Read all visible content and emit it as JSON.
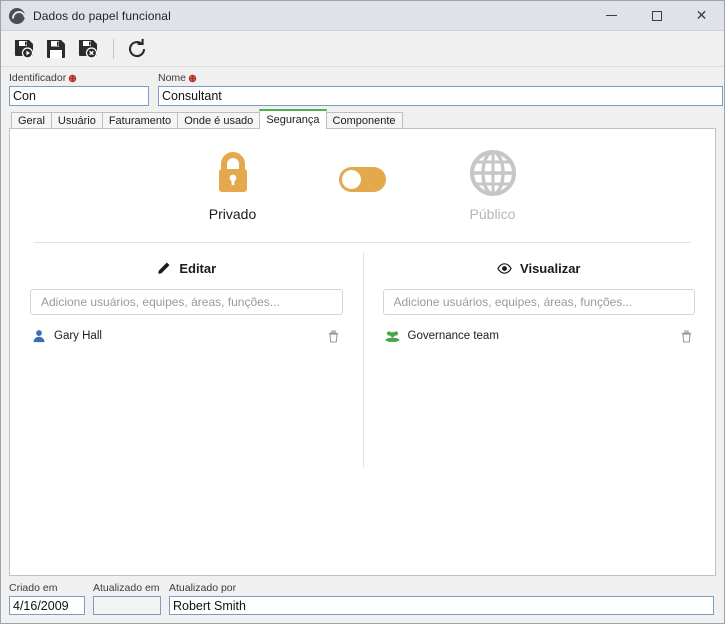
{
  "window": {
    "title": "Dados do papel funcional",
    "app_icon": "swoosh-circle-icon",
    "controls": {
      "minimize": "minimize-icon",
      "maximize": "maximize-icon",
      "close": "close-icon"
    }
  },
  "toolbar": {
    "buttons": [
      {
        "name": "save-new-button",
        "icon": "floppy-disk-new-icon"
      },
      {
        "name": "save-button",
        "icon": "floppy-disk-icon"
      },
      {
        "name": "save-delete-button",
        "icon": "floppy-disk-delete-icon"
      },
      {
        "name": "refresh-button",
        "icon": "refresh-icon"
      }
    ]
  },
  "header_fields": {
    "identificador": {
      "label": "Identificador",
      "value": "Con",
      "required": true
    },
    "nome": {
      "label": "Nome",
      "value": "Consultant",
      "required": true
    }
  },
  "tabs": [
    {
      "label": "Geral",
      "active": false
    },
    {
      "label": "Usuário",
      "active": false
    },
    {
      "label": "Faturamento",
      "active": false
    },
    {
      "label": "Onde é usado",
      "active": false
    },
    {
      "label": "Segurança",
      "active": true
    },
    {
      "label": "Componente",
      "active": false
    }
  ],
  "privacy": {
    "private": {
      "label": "Privado",
      "icon": "padlock-icon",
      "active": true
    },
    "public": {
      "label": "Público",
      "icon": "globe-icon",
      "active": false
    },
    "toggle": {
      "name": "privacy-toggle",
      "state": "off",
      "position": "left"
    }
  },
  "columns": {
    "edit": {
      "title": "Editar",
      "icon": "pencil-icon",
      "placeholder": "Adicione usuários, equipes, áreas, funções...",
      "value": "",
      "entries": [
        {
          "name": "Gary Hall",
          "type": "user",
          "icon": "user-icon",
          "delete_icon": "trash-icon"
        }
      ]
    },
    "view": {
      "title": "Visualizar",
      "icon": "eye-icon",
      "placeholder": "Adicione usuários, equipes, áreas, funções...",
      "value": "",
      "entries": [
        {
          "name": "Governance team",
          "type": "team",
          "icon": "team-icon",
          "delete_icon": "trash-icon"
        }
      ]
    }
  },
  "footer": {
    "criado_em": {
      "label": "Criado em",
      "value": "4/16/2009"
    },
    "atualizado_em": {
      "label": "Atualizado em",
      "value": ""
    },
    "atualizado_por": {
      "label": "Atualizado por",
      "value": "Robert Smith"
    }
  },
  "colors": {
    "accent_orange": "#e4a84d",
    "tab_active_green": "#4caf50",
    "user_blue": "#3a6fb5",
    "team_green": "#45a545",
    "inactive_gray": "#b6b6b6",
    "required_red": "#d8443a"
  }
}
